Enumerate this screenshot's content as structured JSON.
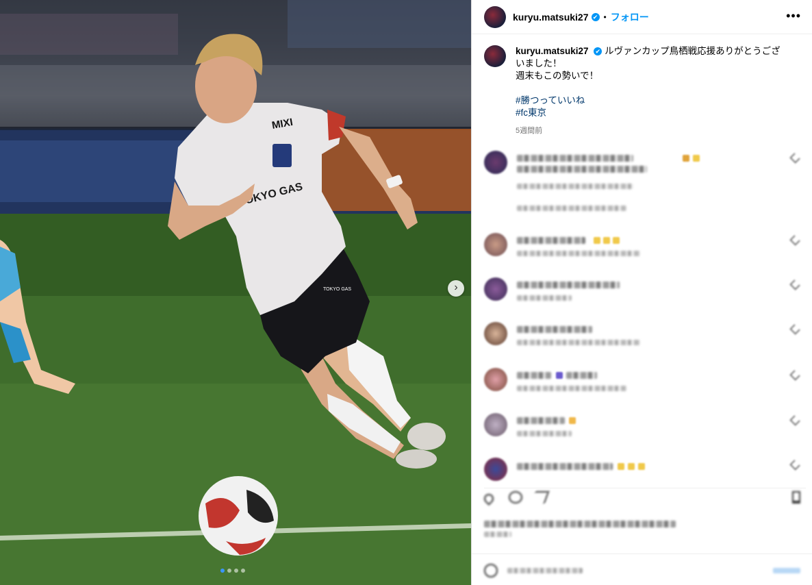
{
  "post": {
    "username": "kuryu.matsuki27",
    "verified_mark": "✔",
    "separator": "•",
    "follow_label": "フォロー",
    "more_label": "•••"
  },
  "caption": {
    "username": "kuryu.matsuki27",
    "text_line1": "ルヴァンカップ鳥栖戦応援ありがとうござ",
    "text_line2": "いました！",
    "text_line3": "週末もこの勢いで！",
    "hashtags": [
      "#勝つっていいね",
      "#fc東京"
    ],
    "time": "5週間前"
  },
  "media": {
    "jersey_sponsor": "MIXI",
    "jersey_main": "TOKYO GAS",
    "shorts_logo": "TOKYO GAS",
    "carousel_next_icon": "›",
    "carousel_pages": 4,
    "carousel_active_index": 0
  },
  "colors": {
    "accent_blue": "#0095f6",
    "hashtag": "#00376b",
    "time_gray": "#737373"
  },
  "icons": [
    "verified-badge-icon",
    "more-options-icon",
    "chevron-right-icon",
    "heart-icon",
    "comment-icon",
    "share-icon",
    "save-icon",
    "emoji-icon"
  ]
}
